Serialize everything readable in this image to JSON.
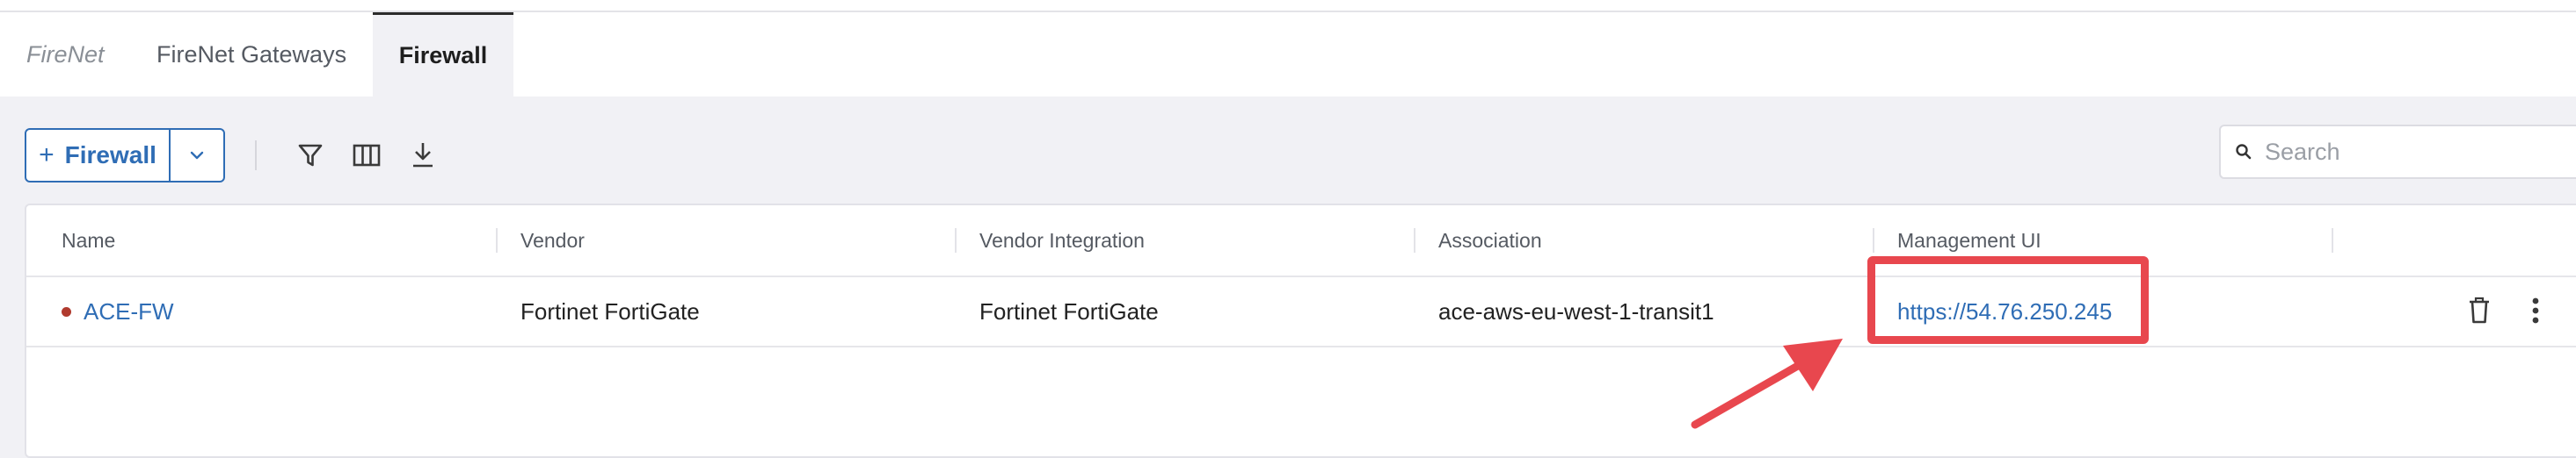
{
  "tabs": {
    "crumb": "FireNet",
    "gateways": "FireNet Gateways",
    "active": "Firewall"
  },
  "toolbar": {
    "add_button": "Firewall",
    "add_plus": "+",
    "icons": [
      "filter-icon",
      "columns-icon",
      "download-icon"
    ]
  },
  "search": {
    "placeholder": "Search",
    "value": ""
  },
  "table": {
    "columns": [
      "Name",
      "Vendor",
      "Vendor Integration",
      "Association",
      "Management UI"
    ],
    "rows": [
      {
        "status_color": "#b03a2e",
        "name": "ACE-FW",
        "vendor": "Fortinet FortiGate",
        "vendor_integration": "Fortinet FortiGate",
        "association": "ace-aws-eu-west-1-transit1",
        "management_ui": "https://54.76.250.245"
      }
    ]
  },
  "colors": {
    "accent": "#2f6db5",
    "annotation": "#e8474e",
    "status_down": "#b03a2e"
  }
}
